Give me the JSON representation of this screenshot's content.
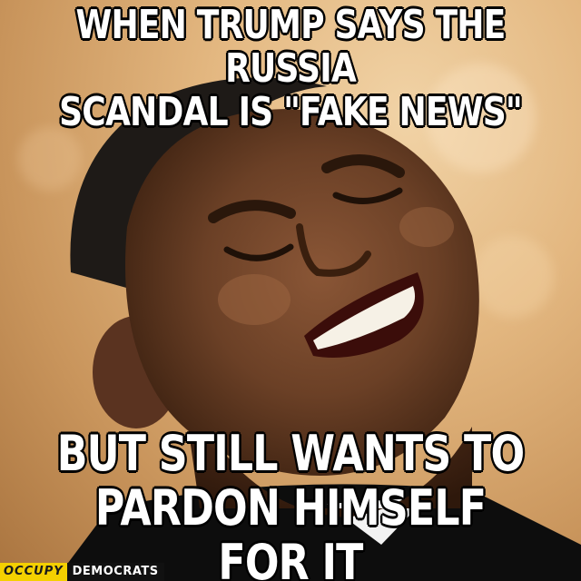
{
  "meme": {
    "top_text": [
      "WHEN TRUMP SAYS THE RUSSIA",
      "SCANDAL IS \"FAKE NEWS\""
    ],
    "bottom_text": [
      "BUT STILL WANTS TO",
      "PARDON HIMSELF FOR IT"
    ]
  },
  "watermark": {
    "part1": "OCCUPY",
    "part2": "DEMOCRATS"
  },
  "colors": {
    "background": "#d9a96f",
    "skin": "#6b4026",
    "watermark_yellow": "#f4d000",
    "watermark_dark": "#111111"
  },
  "image_subject": "laughing-man-photo"
}
